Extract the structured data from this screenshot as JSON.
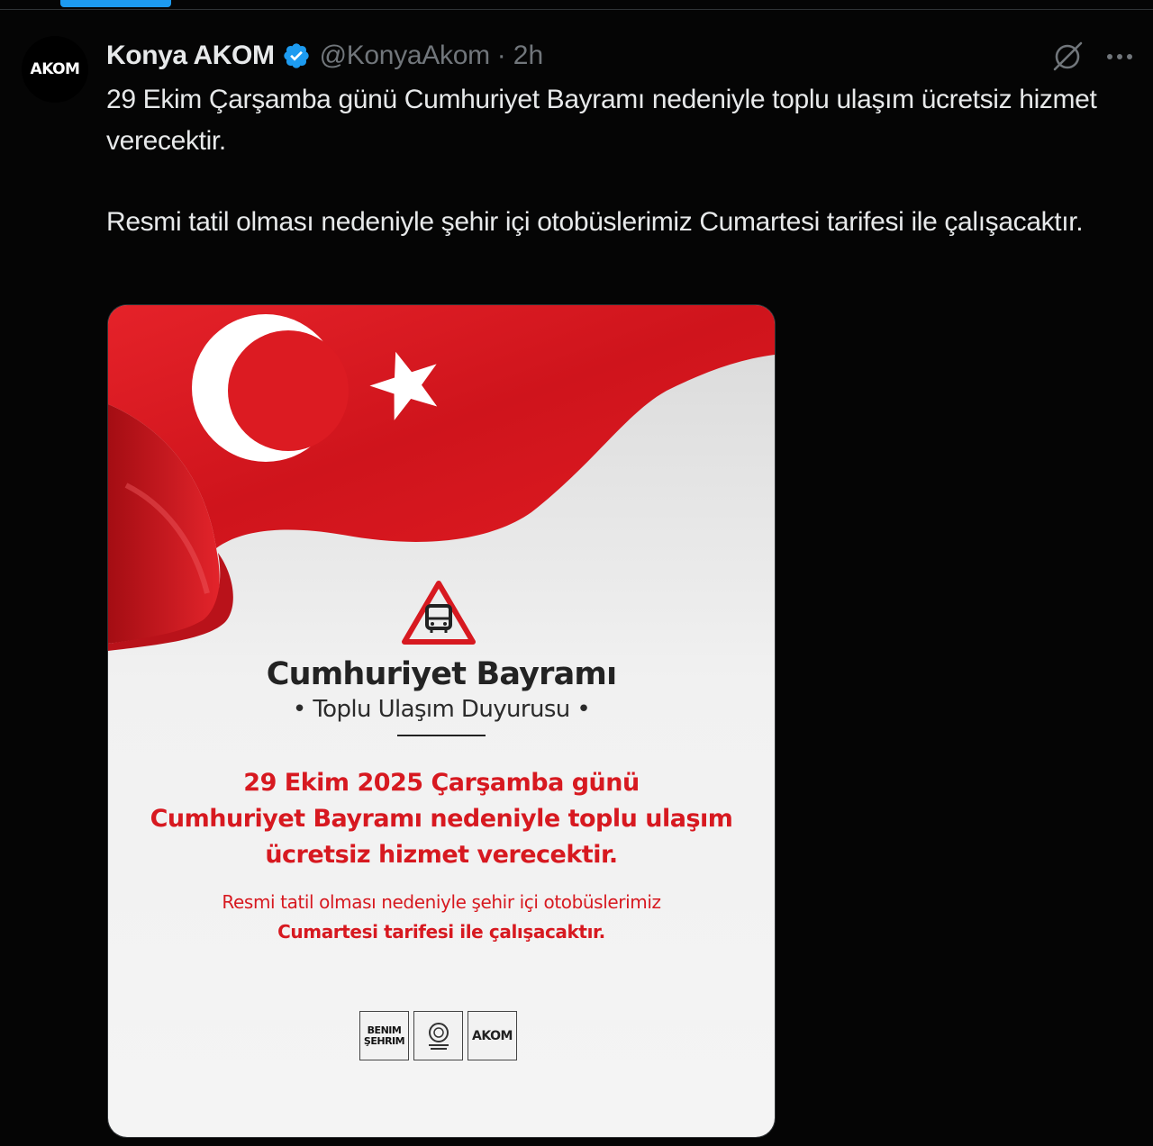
{
  "colors": {
    "background": "#050505",
    "accent": "#1d9bf0",
    "text_primary": "#e7e9ea",
    "text_secondary": "#71767b",
    "poster_red": "#d71920",
    "flag_red": "#e01b22"
  },
  "account": {
    "avatar_text": "AKOM",
    "display_name": "Konya AKOM",
    "handle": "@KonyaAkom",
    "separator": "·",
    "time": "2h"
  },
  "tweet": {
    "paragraph1": "29 Ekim Çarşamba günü Cumhuriyet Bayramı nedeniyle toplu ulaşım ücretsiz hizmet verecektir.",
    "paragraph2": "Resmi tatil olması nedeniyle şehir içi otobüslerimiz Cumartesi tarifesi ile çalışacaktır."
  },
  "poster": {
    "title": "Cumhuriyet Bayramı",
    "subtitle": "• Toplu Ulaşım Duyurusu •",
    "headline_line1": "29 Ekim 2025 Çarşamba günü",
    "headline_line2": "Cumhuriyet Bayramı nedeniyle toplu ulaşım",
    "headline_line3": "ücretsiz hizmet verecektir.",
    "body_line1": "Resmi tatil olması nedeniyle şehir içi otobüslerimiz",
    "body_line2": "Cumartesi tarifesi ile çalışacaktır.",
    "logo1_line1": "BENIM",
    "logo1_line2": "ŞEHRIM",
    "logo3_text": "AKOM"
  },
  "icons": {
    "verified": "verified-badge-icon",
    "grok": "grok-icon",
    "more": "more-icon",
    "warning": "bus-warning-icon",
    "flag": "turkish-flag"
  }
}
